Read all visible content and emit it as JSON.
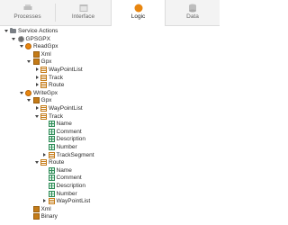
{
  "tabs": [
    {
      "label": "Processes",
      "icon": "processes-icon",
      "active": false
    },
    {
      "label": "Interface",
      "icon": "interface-icon",
      "active": false
    },
    {
      "label": "Logic",
      "icon": "logic-icon",
      "active": true
    },
    {
      "label": "Data",
      "icon": "data-icon",
      "active": false
    }
  ],
  "colors": {
    "accent": "#e8860f",
    "structure": "#c47b17",
    "attribute": "#2e8b57"
  },
  "tree": [
    {
      "label": "Service Actions",
      "depth": 0,
      "twisty": "down",
      "icon": "folder"
    },
    {
      "label": "GPSGPX",
      "depth": 1,
      "twisty": "down",
      "icon": "gear"
    },
    {
      "label": "ReadGpx",
      "depth": 2,
      "twisty": "down",
      "icon": "action"
    },
    {
      "label": "Xml",
      "depth": 3,
      "twisty": "",
      "icon": "struct"
    },
    {
      "label": "Gpx",
      "depth": 3,
      "twisty": "down",
      "icon": "struct"
    },
    {
      "label": "WayPointList",
      "depth": 4,
      "twisty": "right",
      "icon": "list"
    },
    {
      "label": "Track",
      "depth": 4,
      "twisty": "right",
      "icon": "list"
    },
    {
      "label": "Route",
      "depth": 4,
      "twisty": "right",
      "icon": "list"
    },
    {
      "label": "WriteGpx",
      "depth": 2,
      "twisty": "down",
      "icon": "action"
    },
    {
      "label": "Gpx",
      "depth": 3,
      "twisty": "down",
      "icon": "struct"
    },
    {
      "label": "WayPointList",
      "depth": 4,
      "twisty": "right",
      "icon": "list"
    },
    {
      "label": "Track",
      "depth": 4,
      "twisty": "down",
      "icon": "list"
    },
    {
      "label": "Name",
      "depth": 5,
      "twisty": "",
      "icon": "grid"
    },
    {
      "label": "Comment",
      "depth": 5,
      "twisty": "",
      "icon": "grid"
    },
    {
      "label": "Description",
      "depth": 5,
      "twisty": "",
      "icon": "grid"
    },
    {
      "label": "Number",
      "depth": 5,
      "twisty": "",
      "icon": "grid"
    },
    {
      "label": "TrackSegment",
      "depth": 5,
      "twisty": "right",
      "icon": "list"
    },
    {
      "label": "Route",
      "depth": 4,
      "twisty": "down",
      "icon": "list"
    },
    {
      "label": "Name",
      "depth": 5,
      "twisty": "",
      "icon": "grid"
    },
    {
      "label": "Comment",
      "depth": 5,
      "twisty": "",
      "icon": "grid"
    },
    {
      "label": "Description",
      "depth": 5,
      "twisty": "",
      "icon": "grid"
    },
    {
      "label": "Number",
      "depth": 5,
      "twisty": "",
      "icon": "grid"
    },
    {
      "label": "WayPointList",
      "depth": 5,
      "twisty": "right",
      "icon": "list"
    },
    {
      "label": "Xml",
      "depth": 3,
      "twisty": "",
      "icon": "struct"
    },
    {
      "label": "Binary",
      "depth": 3,
      "twisty": "",
      "icon": "struct"
    }
  ]
}
